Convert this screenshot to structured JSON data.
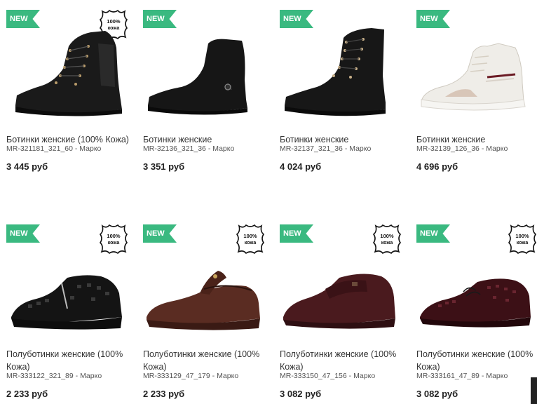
{
  "badge_label": "NEW",
  "leather_badge_text_top": "100%",
  "leather_badge_text_bottom": "кожа",
  "colors": {
    "badge_green": "#3ab980",
    "text": "#333333",
    "price": "#222222"
  },
  "products": [
    {
      "title": "Ботинки женские (100% Кожа)",
      "sku": "MR-321181_321_60 - Марко",
      "price": "3 445 руб",
      "leather_badge": true,
      "style": "black-high-boot"
    },
    {
      "title": "Ботинки женские",
      "sku": "MR-32136_321_36 - Марко",
      "price": "3 351 руб",
      "leather_badge": false,
      "style": "black-ankle-boot"
    },
    {
      "title": "Ботинки женские",
      "sku": "MR-32137_321_36 - Марко",
      "price": "4 024 руб",
      "leather_badge": false,
      "style": "black-lace-boot"
    },
    {
      "title": "Ботинки женские",
      "sku": "MR-32139_126_36 - Марко",
      "price": "4 696 руб",
      "leather_badge": false,
      "style": "white-sneaker"
    },
    {
      "title": "Полуботинки женские (100% Кожа)",
      "sku": "MR-333122_321_89 - Марко",
      "price": "2 233 руб",
      "leather_badge": true,
      "style": "black-croc-shoe"
    },
    {
      "title": "Полуботинки женские (100% Кожа)",
      "sku": "MR-333129_47_179 - Марко",
      "price": "2 233 руб",
      "leather_badge": true,
      "style": "brown-strap-shoe"
    },
    {
      "title": "Полуботинки женские (100% Кожа)",
      "sku": "MR-333150_47_156 - Марко",
      "price": "3 082 руб",
      "leather_badge": true,
      "style": "burgundy-velcro-shoe"
    },
    {
      "title": "Полуботинки женские (100% Кожа)",
      "sku": "MR-333161_47_89 - Марко",
      "price": "3 082 руб",
      "leather_badge": true,
      "style": "burgundy-croc-shoe"
    }
  ]
}
